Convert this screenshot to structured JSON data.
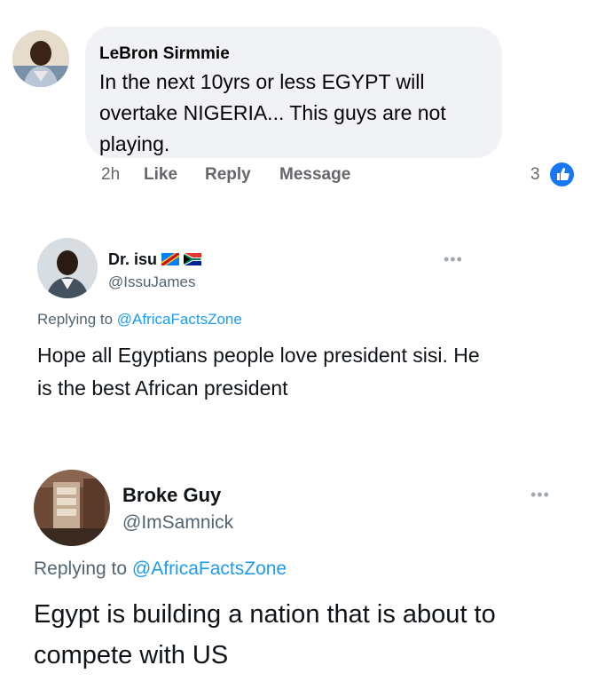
{
  "fb_comment": {
    "author": "LeBron Sirmmie",
    "text": "In the next 10yrs  or less EGYPT will overtake NIGERIA... This guys are not playing.",
    "time": "2h",
    "actions": [
      "Like",
      "Reply",
      "Message"
    ],
    "reaction_count": "3",
    "reaction_icon": "thumbs-up-icon",
    "colors": {
      "bubble": "#f0f2f5",
      "meta": "#65676b",
      "like_blue": "#1877f2"
    }
  },
  "tweets": [
    {
      "name": "Dr. isu",
      "name_emoji": [
        "congo-flag-icon",
        "south-africa-flag-icon"
      ],
      "handle": "@IssuJames",
      "reply_prefix": "Replying to",
      "reply_to": "@AfricaFactsZone",
      "text": "Hope all Egyptians people love president sisi.  He is the best African president"
    },
    {
      "name": "Broke Guy",
      "handle": "@ImSamnick",
      "reply_prefix": "Replying to",
      "reply_to": "@AfricaFactsZone",
      "text": "Egypt is building a nation that is about to compete with US"
    }
  ],
  "colors": {
    "mention": "#1d9bf0",
    "handle": "#536471",
    "text": "#0f1419"
  }
}
